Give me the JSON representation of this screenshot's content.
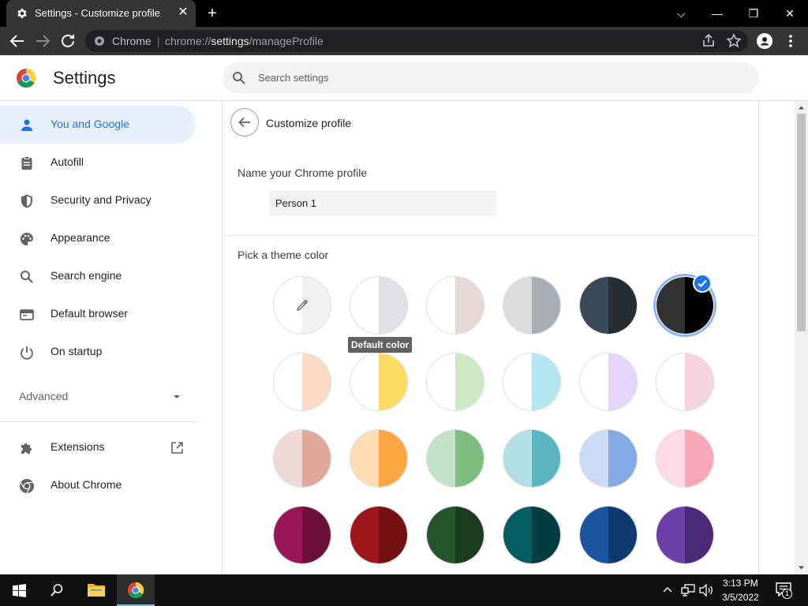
{
  "window": {
    "tab_title": "Settings - Customize profile",
    "close_tab": "✕",
    "new_tab": "+",
    "minimize": "—",
    "restore": "❐",
    "close": "✕",
    "expand": "⌵"
  },
  "omnibox": {
    "site_name": "Chrome",
    "separator": "|",
    "url_scheme": "chrome://",
    "url_host": "settings",
    "url_path": "/manageProfile"
  },
  "header": {
    "title": "Settings",
    "search_placeholder": "Search settings"
  },
  "sidebar": {
    "items": [
      {
        "label": "You and Google",
        "icon": "person-icon",
        "active": true
      },
      {
        "label": "Autofill",
        "icon": "clipboard-icon"
      },
      {
        "label": "Security and Privacy",
        "icon": "shield-icon"
      },
      {
        "label": "Appearance",
        "icon": "palette-icon"
      },
      {
        "label": "Search engine",
        "icon": "search-icon"
      },
      {
        "label": "Default browser",
        "icon": "browser-icon"
      },
      {
        "label": "On startup",
        "icon": "power-icon"
      }
    ],
    "advanced": "Advanced",
    "extensions": "Extensions",
    "about": "About Chrome"
  },
  "panel": {
    "title": "Customize profile",
    "name_label": "Name your Chrome profile",
    "name_value": "Person 1",
    "theme_label": "Pick a theme color",
    "tooltip": "Default color"
  },
  "theme_colors": [
    [
      "#ffffff",
      "#eef1f3"
    ],
    [
      "#ffffff",
      "#dee1e6"
    ],
    [
      "#ffffff",
      "#e6d8d6"
    ],
    [
      "#dadce0",
      "#a9adb6"
    ],
    [
      "#3b4a57",
      "#262d33"
    ],
    [
      "#323232",
      "#000000"
    ],
    [
      "#ffffff",
      "#fbd9c7"
    ],
    [
      "#ffffff",
      "#fddb63"
    ],
    [
      "#ffffff",
      "#cde8c7"
    ],
    [
      "#ffffff",
      "#b3e6f0"
    ],
    [
      "#ffffff",
      "#e6d5fb"
    ],
    [
      "#ffffff",
      "#f6d4e2"
    ],
    [
      "#efd9d6",
      "#e0a89c"
    ],
    [
      "#fddcb2",
      "#fba844"
    ],
    [
      "#c2e2c7",
      "#7ebd80"
    ],
    [
      "#b1dfe3",
      "#5ab5bf"
    ],
    [
      "#cbdaf5",
      "#85a9e4"
    ],
    [
      "#fcdbe4",
      "#f8a7b7"
    ],
    [
      "#9a1656",
      "#6b0f3b"
    ],
    [
      "#a1161c",
      "#721012"
    ],
    [
      "#27552b",
      "#1b3c1d"
    ],
    [
      "#055d63",
      "#043d41"
    ],
    [
      "#1c54a0",
      "#0f3a70"
    ],
    [
      "#6d3fa8",
      "#4b2a78"
    ]
  ],
  "selected_color_index": 5,
  "taskbar": {
    "time": "3:13 PM",
    "date": "3/5/2022",
    "notification_count": "1"
  },
  "colors": {
    "accent": "#1a73e8",
    "active_bg": "#e8f0fe"
  }
}
